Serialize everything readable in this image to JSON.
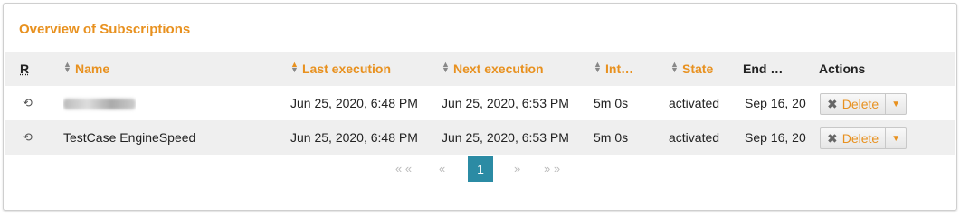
{
  "panel": {
    "title": "Overview of Subscriptions"
  },
  "table": {
    "headers": {
      "r": "R",
      "name": "Name",
      "last_execution": "Last execution",
      "next_execution": "Next execution",
      "interval": "Int…",
      "state": "State",
      "end": "End …",
      "actions": "Actions"
    },
    "rows": [
      {
        "name": "",
        "last_execution": "Jun 25, 2020, 6:48 PM",
        "next_execution": "Jun 25, 2020, 6:53 PM",
        "interval": "5m 0s",
        "state": "activated",
        "end": "Sep 16, 20",
        "delete": "Delete",
        "refresh_icon": "refresh-icon"
      },
      {
        "name": "TestCase EngineSpeed",
        "last_execution": "Jun 25, 2020, 6:48 PM",
        "next_execution": "Jun 25, 2020, 6:53 PM",
        "interval": "5m 0s",
        "state": "activated",
        "end": "Sep 16, 20",
        "delete": "Delete",
        "refresh_icon": "refresh-icon"
      }
    ]
  },
  "pager": {
    "first": "« «",
    "prev": "«",
    "current": "1",
    "next": "»",
    "last": "» »"
  },
  "colors": {
    "accent": "#e8911f",
    "pager_active": "#2b8ba4"
  }
}
